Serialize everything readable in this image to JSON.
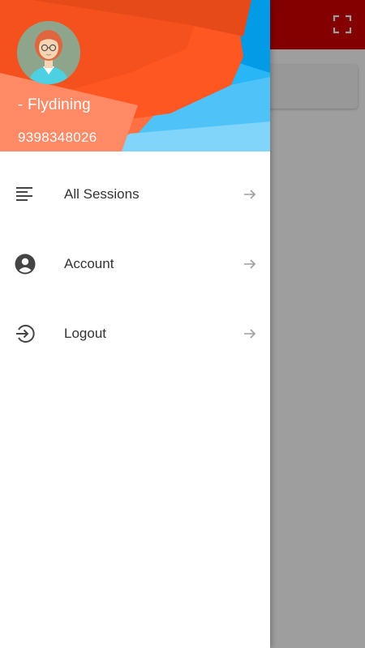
{
  "user": {
    "name": "- Flydining",
    "phone": "9398348026"
  },
  "menu": {
    "items": [
      {
        "label": "All Sessions",
        "icon": "list-icon"
      },
      {
        "label": "Account",
        "icon": "account-circle-icon"
      },
      {
        "label": "Logout",
        "icon": "logout-icon"
      }
    ]
  },
  "colors": {
    "appbar": "#d50000",
    "header_orange": "#ff5722",
    "header_blue": "#29b6f6",
    "text": "#333333",
    "icon": "#444444",
    "arrow": "#9e9e9e"
  }
}
